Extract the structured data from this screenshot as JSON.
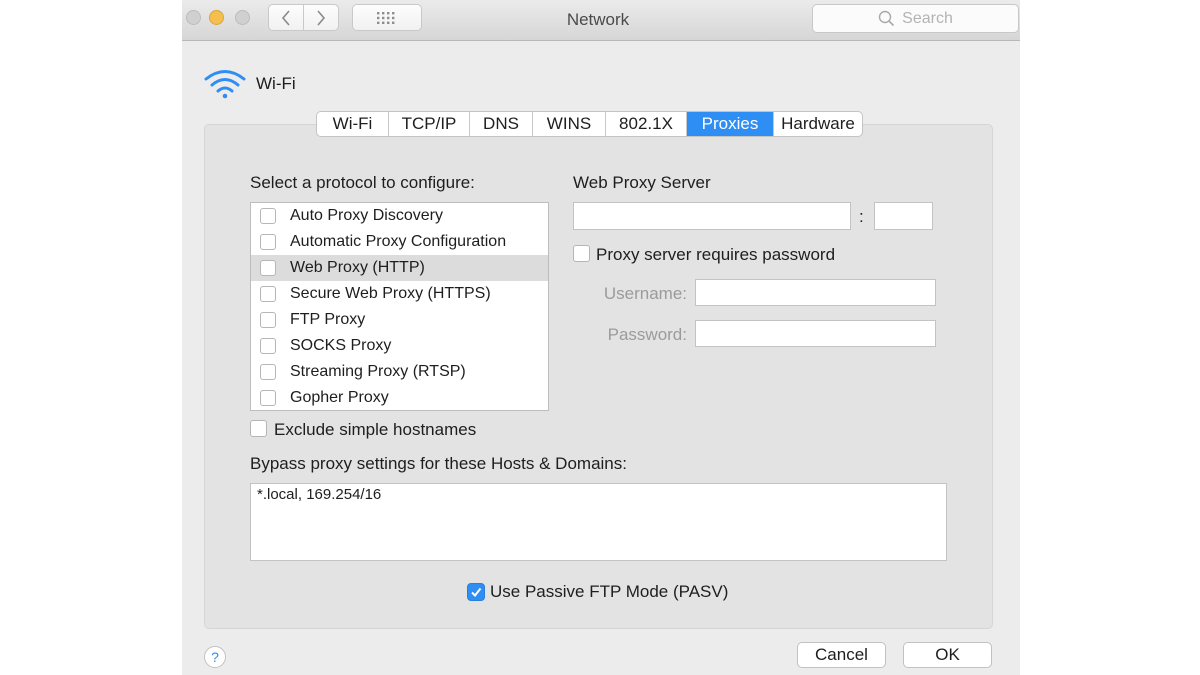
{
  "window": {
    "title": "Network",
    "search_placeholder": "Search"
  },
  "toolbar_icons": {
    "back": "chevron-left-icon",
    "forward": "chevron-right-icon",
    "show_all": "grid-icon",
    "search": "search-icon"
  },
  "service": {
    "name": "Wi-Fi",
    "icon": "wifi-icon"
  },
  "tabs": [
    {
      "label": "Wi-Fi",
      "active": false
    },
    {
      "label": "TCP/IP",
      "active": false
    },
    {
      "label": "DNS",
      "active": false
    },
    {
      "label": "WINS",
      "active": false
    },
    {
      "label": "802.1X",
      "active": false
    },
    {
      "label": "Proxies",
      "active": true
    },
    {
      "label": "Hardware",
      "active": false
    }
  ],
  "protocols": {
    "heading": "Select a protocol to configure:",
    "items": [
      {
        "label": "Auto Proxy Discovery",
        "checked": false,
        "selected": false
      },
      {
        "label": "Automatic Proxy Configuration",
        "checked": false,
        "selected": false
      },
      {
        "label": "Web Proxy (HTTP)",
        "checked": false,
        "selected": true
      },
      {
        "label": "Secure Web Proxy (HTTPS)",
        "checked": false,
        "selected": false
      },
      {
        "label": "FTP Proxy",
        "checked": false,
        "selected": false
      },
      {
        "label": "SOCKS Proxy",
        "checked": false,
        "selected": false
      },
      {
        "label": "Streaming Proxy (RTSP)",
        "checked": false,
        "selected": false
      },
      {
        "label": "Gopher Proxy",
        "checked": false,
        "selected": false
      }
    ]
  },
  "server": {
    "heading": "Web Proxy Server",
    "host_value": "",
    "port_separator": ":",
    "port_value": "",
    "requires_password_label": "Proxy server requires password",
    "requires_password_checked": false,
    "username_label": "Username:",
    "username_value": "",
    "password_label": "Password:",
    "password_value": ""
  },
  "exclude": {
    "label": "Exclude simple hostnames",
    "checked": false
  },
  "bypass": {
    "label": "Bypass proxy settings for these Hosts & Domains:",
    "value": "*.local, 169.254/16"
  },
  "pasv": {
    "label": "Use Passive FTP Mode (PASV)",
    "checked": true
  },
  "buttons": {
    "help": "?",
    "cancel": "Cancel",
    "ok": "OK"
  },
  "colors": {
    "accent": "#2e8ef4",
    "minimize": "#f5bf4f"
  }
}
